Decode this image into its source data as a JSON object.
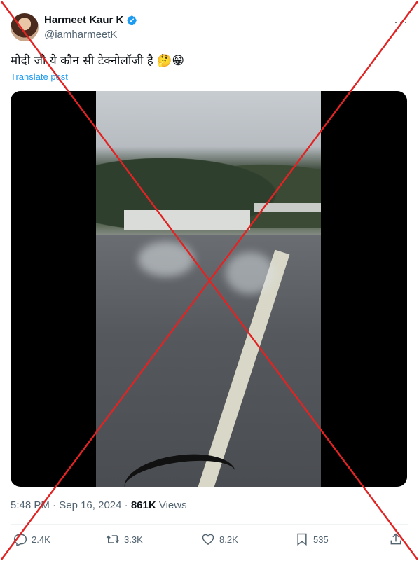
{
  "author": {
    "display_name": "Harmeet Kaur K",
    "handle": "@iamharmeetK"
  },
  "tweet": {
    "text": "मोदी जी ये कौन सी टेक्नोलॉजी है 🤔😁",
    "translate_label": "Translate post"
  },
  "meta": {
    "time": "5:48 PM",
    "separator1": " · ",
    "date": "Sep 16, 2024",
    "separator2": " · ",
    "views_count": "861K",
    "views_label": " Views"
  },
  "actions": {
    "replies": "2.4K",
    "reposts": "3.3K",
    "likes": "8.2K",
    "bookmarks": "535"
  },
  "colors": {
    "accent": "#1d9bf0",
    "cross": "#e02424"
  }
}
